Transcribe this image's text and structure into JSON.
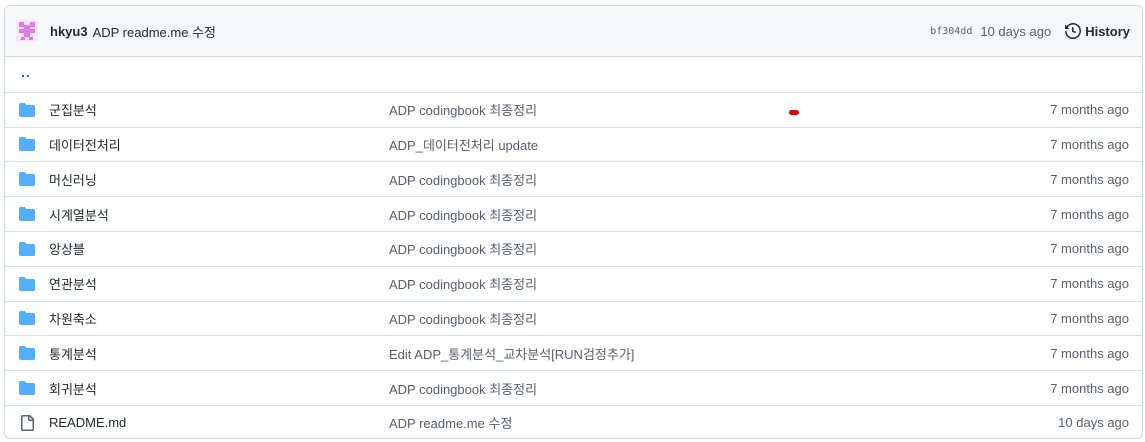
{
  "header": {
    "author": "hkyu3",
    "message": "ADP readme.me 수정",
    "sha": "bf304dd",
    "ago": "10 days ago",
    "history_label": "History"
  },
  "parent": {
    "label": ".."
  },
  "rows": [
    {
      "type": "folder",
      "name": "군집분석",
      "message": "ADP codingbook 최종정리",
      "date": "7 months ago"
    },
    {
      "type": "folder",
      "name": "데이터전처리",
      "message": "ADP_데이터전처리 update",
      "date": "7 months ago"
    },
    {
      "type": "folder",
      "name": "머신러닝",
      "message": "ADP codingbook 최종정리",
      "date": "7 months ago"
    },
    {
      "type": "folder",
      "name": "시계열분석",
      "message": "ADP codingbook 최종정리",
      "date": "7 months ago"
    },
    {
      "type": "folder",
      "name": "앙상블",
      "message": "ADP codingbook 최종정리",
      "date": "7 months ago"
    },
    {
      "type": "folder",
      "name": "연관분석",
      "message": "ADP codingbook 최종정리",
      "date": "7 months ago"
    },
    {
      "type": "folder",
      "name": "차원축소",
      "message": "ADP codingbook 최종정리",
      "date": "7 months ago"
    },
    {
      "type": "folder",
      "name": "통계분석",
      "message": "Edit ADP_통계분석_교차분석[RUN검정추가]",
      "date": "7 months ago"
    },
    {
      "type": "folder",
      "name": "회귀분석",
      "message": "ADP codingbook 최종정리",
      "date": "7 months ago"
    },
    {
      "type": "file",
      "name": "README.md",
      "message": "ADP readme.me 수정",
      "date": "10 days ago"
    }
  ],
  "colors": {
    "folder": "#54aeff",
    "file": "#57606a",
    "avatar": "#e27ce8",
    "link": "#0969da"
  }
}
